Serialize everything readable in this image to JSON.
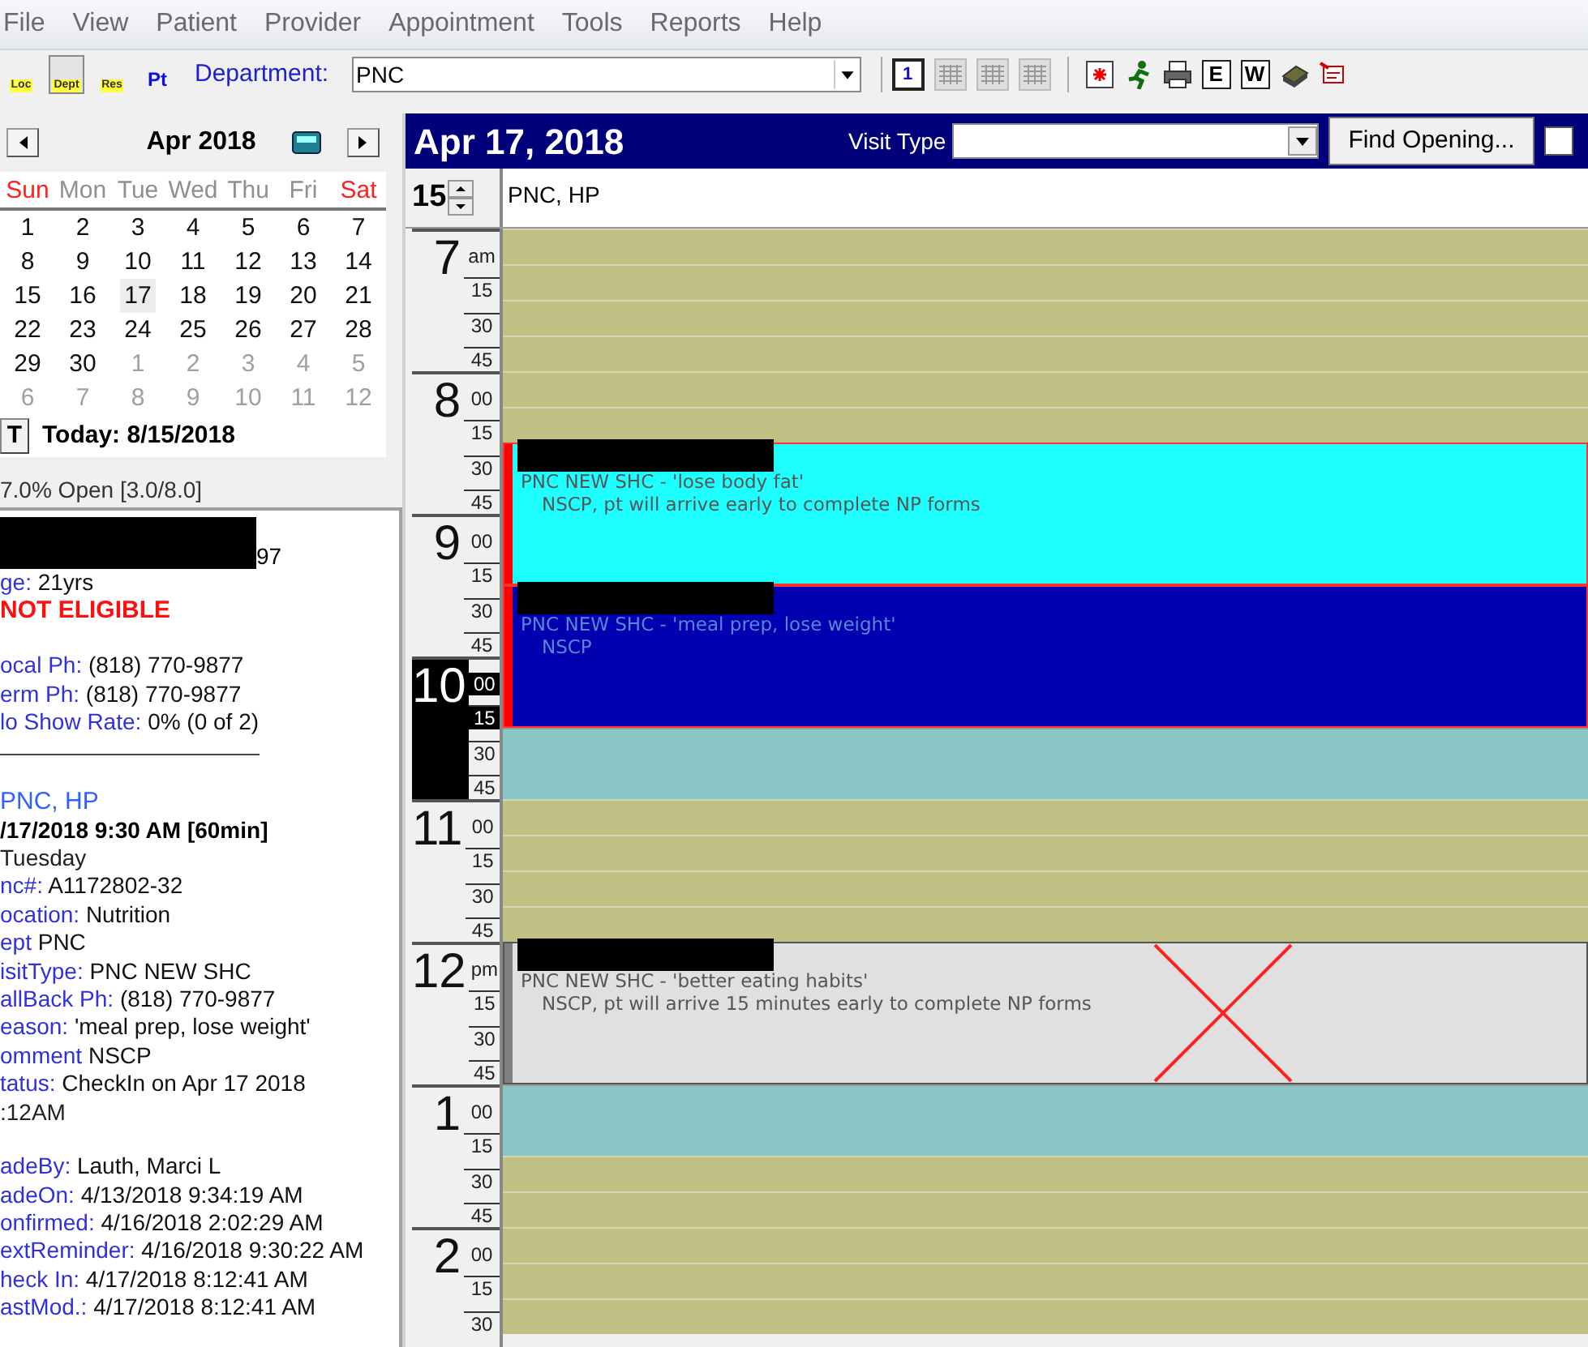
{
  "menu": [
    "File",
    "View",
    "Patient",
    "Provider",
    "Appointment",
    "Tools",
    "Reports",
    "Help"
  ],
  "toolbar": {
    "resource_buttons": [
      {
        "label": "Loc",
        "selected": false
      },
      {
        "label": "Dept",
        "selected": true
      },
      {
        "label": "Res",
        "selected": false
      },
      {
        "label": "Pt",
        "selected": false
      }
    ],
    "department": {
      "label": "Department:",
      "value": "PNC"
    },
    "view_buttons": [
      {
        "label": "1",
        "selected": true
      },
      {
        "selected": false
      },
      {
        "selected": false
      },
      {
        "selected": false
      }
    ],
    "letter_buttons": [
      "E",
      "W"
    ]
  },
  "calendar": {
    "month": "Apr 2018",
    "weekdays": [
      {
        "label": "Sun",
        "weekend": true
      },
      {
        "label": "Mon",
        "weekend": false
      },
      {
        "label": "Tue",
        "weekend": false
      },
      {
        "label": "Wed",
        "weekend": false
      },
      {
        "label": "Thu",
        "weekend": false
      },
      {
        "label": "Fri",
        "weekend": false
      },
      {
        "label": "Sat",
        "weekend": true
      }
    ],
    "weeks": [
      [
        {
          "day": "1",
          "in_month": true,
          "selected": false
        },
        {
          "day": "2",
          "in_month": true,
          "selected": false
        },
        {
          "day": "3",
          "in_month": true,
          "selected": false
        },
        {
          "day": "4",
          "in_month": true,
          "selected": false
        },
        {
          "day": "5",
          "in_month": true,
          "selected": false
        },
        {
          "day": "6",
          "in_month": true,
          "selected": false
        },
        {
          "day": "7",
          "in_month": true,
          "selected": false
        }
      ],
      [
        {
          "day": "8",
          "in_month": true,
          "selected": false
        },
        {
          "day": "9",
          "in_month": true,
          "selected": false
        },
        {
          "day": "10",
          "in_month": true,
          "selected": false
        },
        {
          "day": "11",
          "in_month": true,
          "selected": false
        },
        {
          "day": "12",
          "in_month": true,
          "selected": false
        },
        {
          "day": "13",
          "in_month": true,
          "selected": false
        },
        {
          "day": "14",
          "in_month": true,
          "selected": false
        }
      ],
      [
        {
          "day": "15",
          "in_month": true,
          "selected": false
        },
        {
          "day": "16",
          "in_month": true,
          "selected": false
        },
        {
          "day": "17",
          "in_month": true,
          "selected": true
        },
        {
          "day": "18",
          "in_month": true,
          "selected": false
        },
        {
          "day": "19",
          "in_month": true,
          "selected": false
        },
        {
          "day": "20",
          "in_month": true,
          "selected": false
        },
        {
          "day": "21",
          "in_month": true,
          "selected": false
        }
      ],
      [
        {
          "day": "22",
          "in_month": true,
          "selected": false
        },
        {
          "day": "23",
          "in_month": true,
          "selected": false
        },
        {
          "day": "24",
          "in_month": true,
          "selected": false
        },
        {
          "day": "25",
          "in_month": true,
          "selected": false
        },
        {
          "day": "26",
          "in_month": true,
          "selected": false
        },
        {
          "day": "27",
          "in_month": true,
          "selected": false
        },
        {
          "day": "28",
          "in_month": true,
          "selected": false
        }
      ],
      [
        {
          "day": "29",
          "in_month": true,
          "selected": false
        },
        {
          "day": "30",
          "in_month": true,
          "selected": false
        },
        {
          "day": "1",
          "in_month": false,
          "selected": false
        },
        {
          "day": "2",
          "in_month": false,
          "selected": false
        },
        {
          "day": "3",
          "in_month": false,
          "selected": false
        },
        {
          "day": "4",
          "in_month": false,
          "selected": false
        },
        {
          "day": "5",
          "in_month": false,
          "selected": false
        }
      ],
      [
        {
          "day": "6",
          "in_month": false,
          "selected": false
        },
        {
          "day": "7",
          "in_month": false,
          "selected": false
        },
        {
          "day": "8",
          "in_month": false,
          "selected": false
        },
        {
          "day": "9",
          "in_month": false,
          "selected": false
        },
        {
          "day": "10",
          "in_month": false,
          "selected": false
        },
        {
          "day": "11",
          "in_month": false,
          "selected": false
        },
        {
          "day": "12",
          "in_month": false,
          "selected": false
        }
      ]
    ],
    "today_button": "T",
    "today": "Today: 8/15/2018",
    "open_summary": "7.0% Open [3.0/8.0]"
  },
  "patient_info": [
    {
      "kind": "redacted",
      "text": "97"
    },
    {
      "kind": "field",
      "label": "ge:",
      "value": "21yrs"
    },
    {
      "kind": "alert",
      "text": "NOT ELIGIBLE"
    },
    {
      "kind": "gap"
    },
    {
      "kind": "field",
      "label": "ocal Ph:",
      "value": "(818) 770-9877"
    },
    {
      "kind": "field",
      "label": "erm Ph:",
      "value": "(818) 770-9877"
    },
    {
      "kind": "field",
      "label": "lo Show Rate:",
      "value": "0% (0 of 2)"
    },
    {
      "kind": "divider"
    },
    {
      "kind": "gap"
    },
    {
      "kind": "link",
      "text": "PNC, HP"
    },
    {
      "kind": "bold",
      "text": "/17/2018 9:30 AM [60min]"
    },
    {
      "kind": "plain",
      "text": "Tuesday"
    },
    {
      "kind": "field",
      "label": "nc#:",
      "value": "A1172802-32"
    },
    {
      "kind": "field",
      "label": "ocation:",
      "value": "Nutrition"
    },
    {
      "kind": "field",
      "label": "ept",
      "value": "PNC"
    },
    {
      "kind": "field",
      "label": "isitType:",
      "value": "PNC NEW SHC"
    },
    {
      "kind": "field",
      "label": "allBack Ph:",
      "value": "(818) 770-9877"
    },
    {
      "kind": "field",
      "label": "eason:",
      "value": "'meal prep, lose weight'"
    },
    {
      "kind": "field",
      "label": "omment",
      "value": "NSCP"
    },
    {
      "kind": "field",
      "label": "tatus:",
      "value": "CheckIn on Apr 17 2018"
    },
    {
      "kind": "plain",
      "text": ":12AM"
    },
    {
      "kind": "gap"
    },
    {
      "kind": "field",
      "label": "adeBy:",
      "value": "Lauth, Marci L"
    },
    {
      "kind": "field",
      "label": "adeOn:",
      "value": "4/13/2018 9:34:19 AM"
    },
    {
      "kind": "field",
      "label": "onfirmed:",
      "value": "4/16/2018 2:02:29 AM"
    },
    {
      "kind": "field",
      "label": "extReminder:",
      "value": "4/16/2018 9:30:22 AM"
    },
    {
      "kind": "field",
      "label": "heck In:",
      "value": "4/17/2018 8:12:41 AM"
    },
    {
      "kind": "field",
      "label": "astMod.:",
      "value": "4/17/2018 8:12:41 AM"
    }
  ],
  "schedule": {
    "date": "Apr 17, 2018",
    "visit_type": {
      "label": "Visit Type"
    },
    "find_button": "Find Opening...",
    "checkbox": {
      "checked": false
    },
    "interval": "15",
    "column": "PNC, HP",
    "hours": [
      {
        "hour": "7",
        "selected": false,
        "marks": [
          {
            "label": "am",
            "kind": "open"
          },
          {
            "label": "15"
          },
          {
            "label": "30"
          },
          {
            "label": "45"
          }
        ]
      },
      {
        "hour": "8",
        "selected": false,
        "marks": [
          {
            "label": "00"
          },
          {
            "label": "15"
          },
          {
            "label": "30",
            "kind": "appointment",
            "appointment": {
              "color": "#1effff",
              "name_redacted": true,
              "cancelled": false,
              "line1": "PNC NEW SHC - 'lose body fat'",
              "line2": "NSCP, pt will arrive early to complete NP forms"
            }
          },
          {
            "label": "45"
          }
        ]
      },
      {
        "hour": "9",
        "selected": false,
        "marks": [
          {
            "label": "00"
          },
          {
            "label": "15"
          },
          {
            "label": "30",
            "kind": "appointment",
            "appointment": {
              "color": "#0000b0",
              "name_redacted": true,
              "cancelled": false,
              "line1": "PNC NEW SHC - 'meal prep, lose weight'",
              "line2": "NSCP"
            }
          },
          {
            "label": "45"
          }
        ]
      },
      {
        "hour": "10",
        "selected": true,
        "marks": [
          {
            "label": "00"
          },
          {
            "label": "15"
          },
          {
            "label": "30",
            "kind": "reserved"
          },
          {
            "label": "45"
          }
        ]
      },
      {
        "hour": "11",
        "selected": false,
        "marks": [
          {
            "label": "00",
            "kind": "open"
          },
          {
            "label": "15"
          },
          {
            "label": "30"
          },
          {
            "label": "45"
          }
        ]
      },
      {
        "hour": "12",
        "selected": false,
        "marks": [
          {
            "label": "pm",
            "kind": "appointment",
            "appointment": {
              "color": "#e0e0e0",
              "name_redacted": true,
              "cancelled": true,
              "line1": "PNC NEW SHC - 'better eating habits'",
              "line2": "NSCP, pt will arrive 15 minutes early to complete NP forms"
            }
          },
          {
            "label": "15"
          },
          {
            "label": "30"
          },
          {
            "label": "45"
          }
        ]
      },
      {
        "hour": "1",
        "selected": false,
        "marks": [
          {
            "label": "00",
            "kind": "reserved"
          },
          {
            "label": "15"
          },
          {
            "label": "30",
            "kind": "open"
          },
          {
            "label": "45"
          }
        ]
      },
      {
        "hour": "2",
        "selected": false,
        "marks": [
          {
            "label": "00"
          },
          {
            "label": "15"
          },
          {
            "label": "30"
          }
        ]
      }
    ]
  }
}
